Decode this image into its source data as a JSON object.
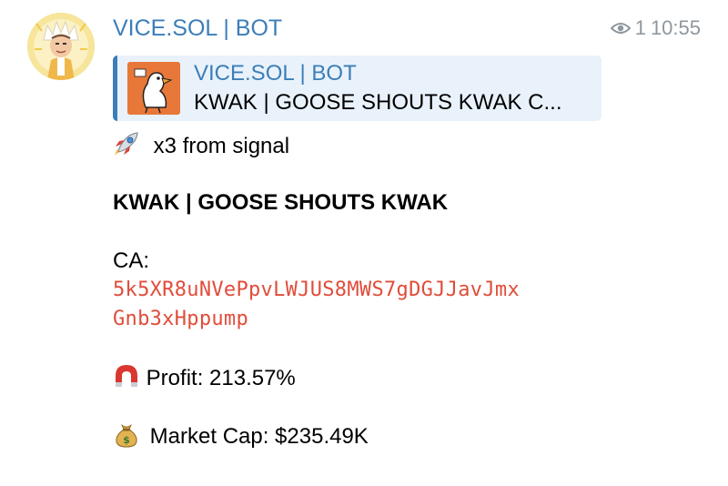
{
  "message": {
    "sender": "VICE.SOL | BOT",
    "views": "1",
    "time": "10:55",
    "reply": {
      "sender": "VICE.SOL | BOT",
      "text": "KWAK | GOOSE SHOUTS KWAK  C..."
    },
    "signal_line": "x3 from signal",
    "token_title": "KWAK | GOOSE SHOUTS KWAK",
    "ca_label": "CA:",
    "ca_line1": "5k5XR8uNVePpvLWJUS8MWS7gDGJJavJmx",
    "ca_line2": "Gnb3xHppump",
    "profit": "Profit: 213.57%",
    "market_cap": "Market Cap: $235.49K",
    "icons": {
      "signal": "rocket-icon",
      "profit": "magnet-icon",
      "market_cap": "money-bag-icon",
      "views": "eye-icon"
    }
  }
}
